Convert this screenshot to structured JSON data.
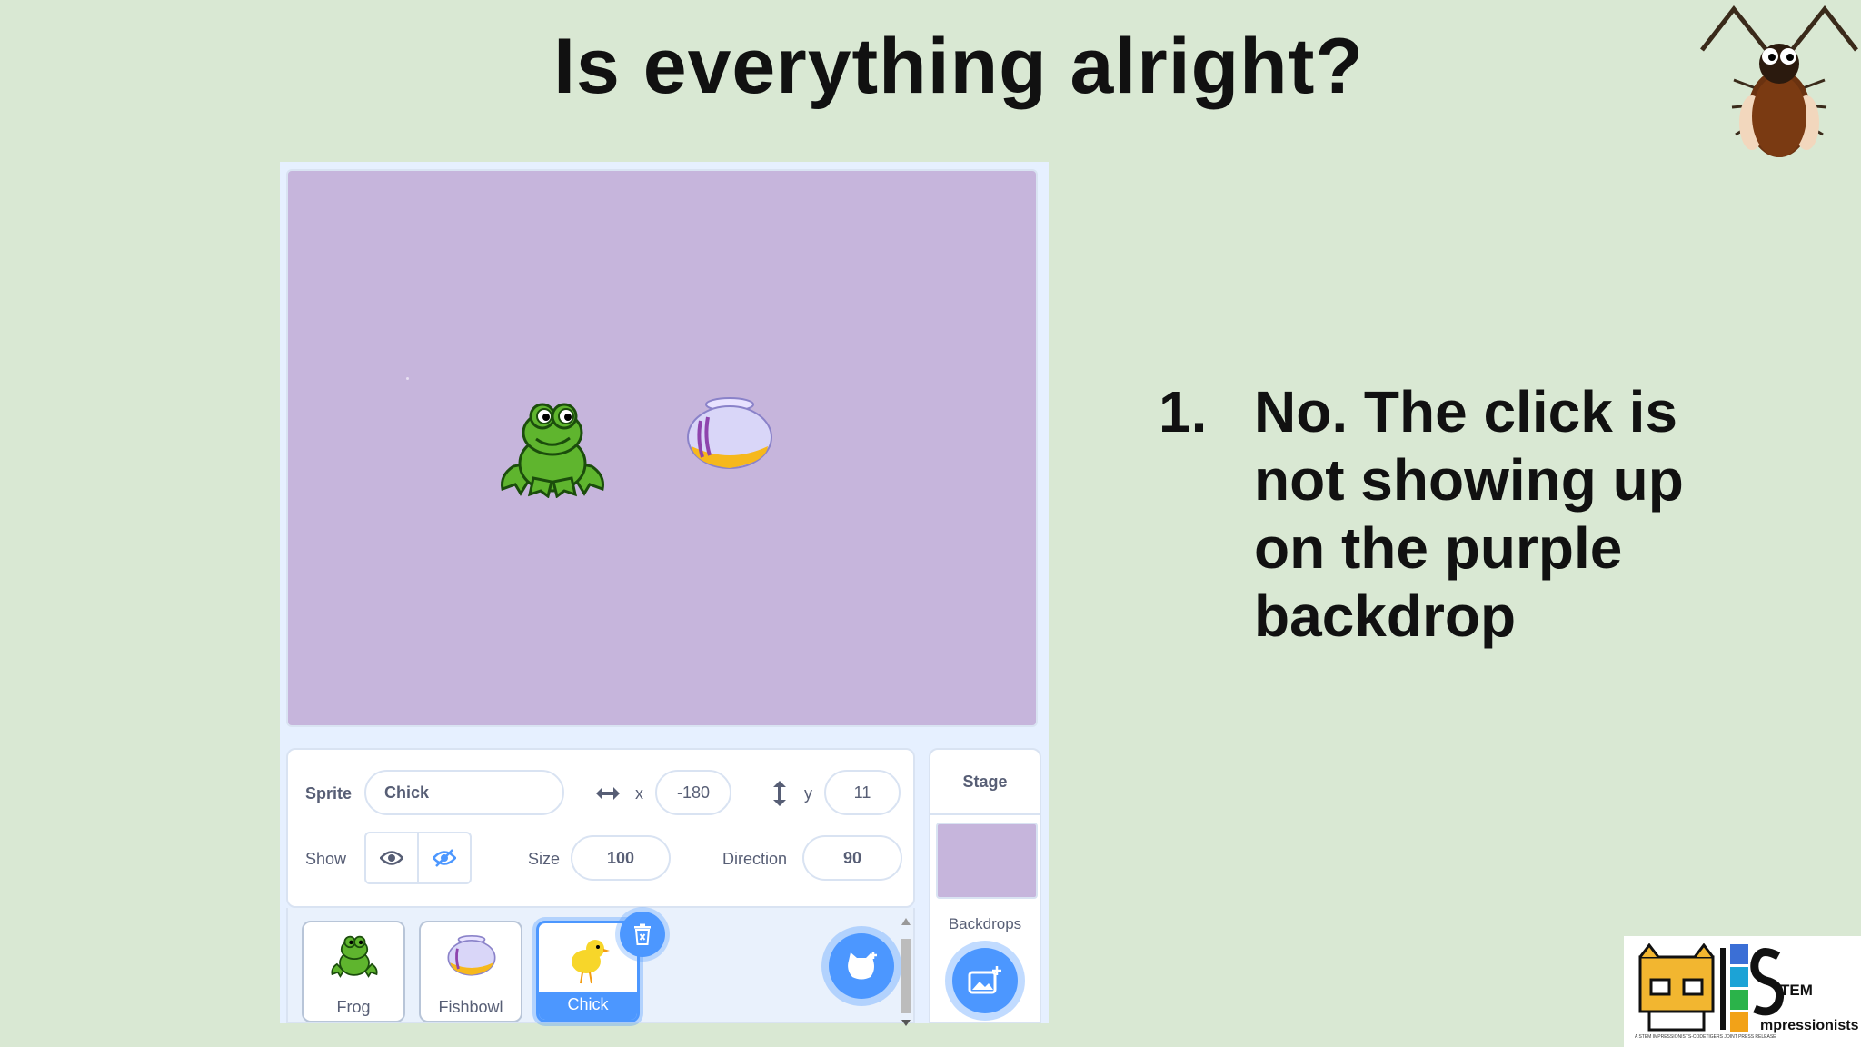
{
  "slide": {
    "title": "Is everything alright?",
    "answer_number": "1.",
    "answer_text": "No. The click is not showing up on the purple backdrop"
  },
  "sprite_info": {
    "sprite_label": "Sprite",
    "sprite_name": "Chick",
    "x_label": "x",
    "x_value": "-180",
    "y_label": "y",
    "y_value": "11",
    "show_label": "Show",
    "size_label": "Size",
    "size_value": "100",
    "direction_label": "Direction",
    "direction_value": "90"
  },
  "sprites": [
    {
      "name": "Frog",
      "selected": false
    },
    {
      "name": "Fishbowl",
      "selected": false
    },
    {
      "name": "Chick",
      "selected": true
    }
  ],
  "stage_panel": {
    "label": "Stage",
    "backdrops_label": "Backdrops"
  },
  "logos": {
    "stem_logo_text_1": "TEM",
    "stem_logo_text_2": "mpressionists",
    "stem_fine_print": "A STEM IMPRESSIONISTS-CODETIGERS JOINT PRESS RELEASE"
  },
  "colors": {
    "slide_background": "#d9e8d3",
    "stage_backdrop": "#c6b5dc",
    "scratch_blue": "#4c97ff"
  }
}
